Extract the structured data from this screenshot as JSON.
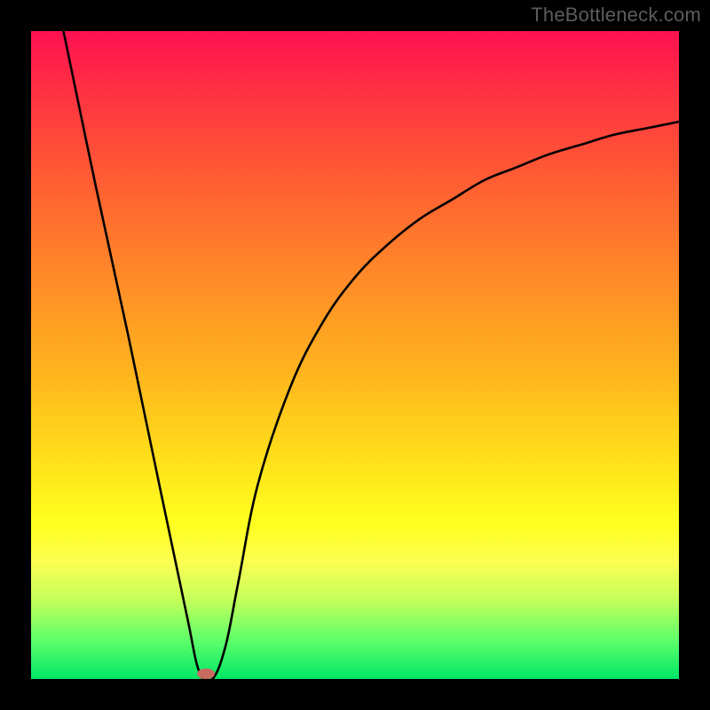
{
  "watermark": "TheBottleneck.com",
  "chart_data": {
    "type": "line",
    "title": "",
    "xlabel": "",
    "ylabel": "",
    "xlim": [
      0,
      100
    ],
    "ylim": [
      0,
      100
    ],
    "background_gradient": {
      "top": "#ff1151",
      "bottom": "#00e765",
      "orientation": "vertical",
      "meaning": "red=high bottleneck, green=low bottleneck"
    },
    "series": [
      {
        "name": "bottleneck-curve",
        "color": "#000000",
        "x": [
          5,
          10,
          15,
          20,
          24,
          26,
          28,
          30,
          32,
          35,
          40,
          45,
          50,
          55,
          60,
          65,
          70,
          75,
          80,
          85,
          90,
          95,
          100
        ],
        "y": [
          100,
          76,
          53,
          29,
          10,
          1,
          0,
          5,
          15,
          30,
          45,
          55,
          62,
          67,
          71,
          74,
          77,
          79,
          81,
          82.5,
          84,
          85,
          86
        ]
      }
    ],
    "marker": {
      "name": "optimal-point",
      "shape": "ellipse",
      "x": 27,
      "y": 0.8,
      "color": "#c76a5f"
    },
    "grid": false,
    "legend": false
  },
  "colors": {
    "frame": "#000000",
    "curve": "#000000",
    "marker": "#c76a5f",
    "watermark": "#5c5c5c"
  }
}
